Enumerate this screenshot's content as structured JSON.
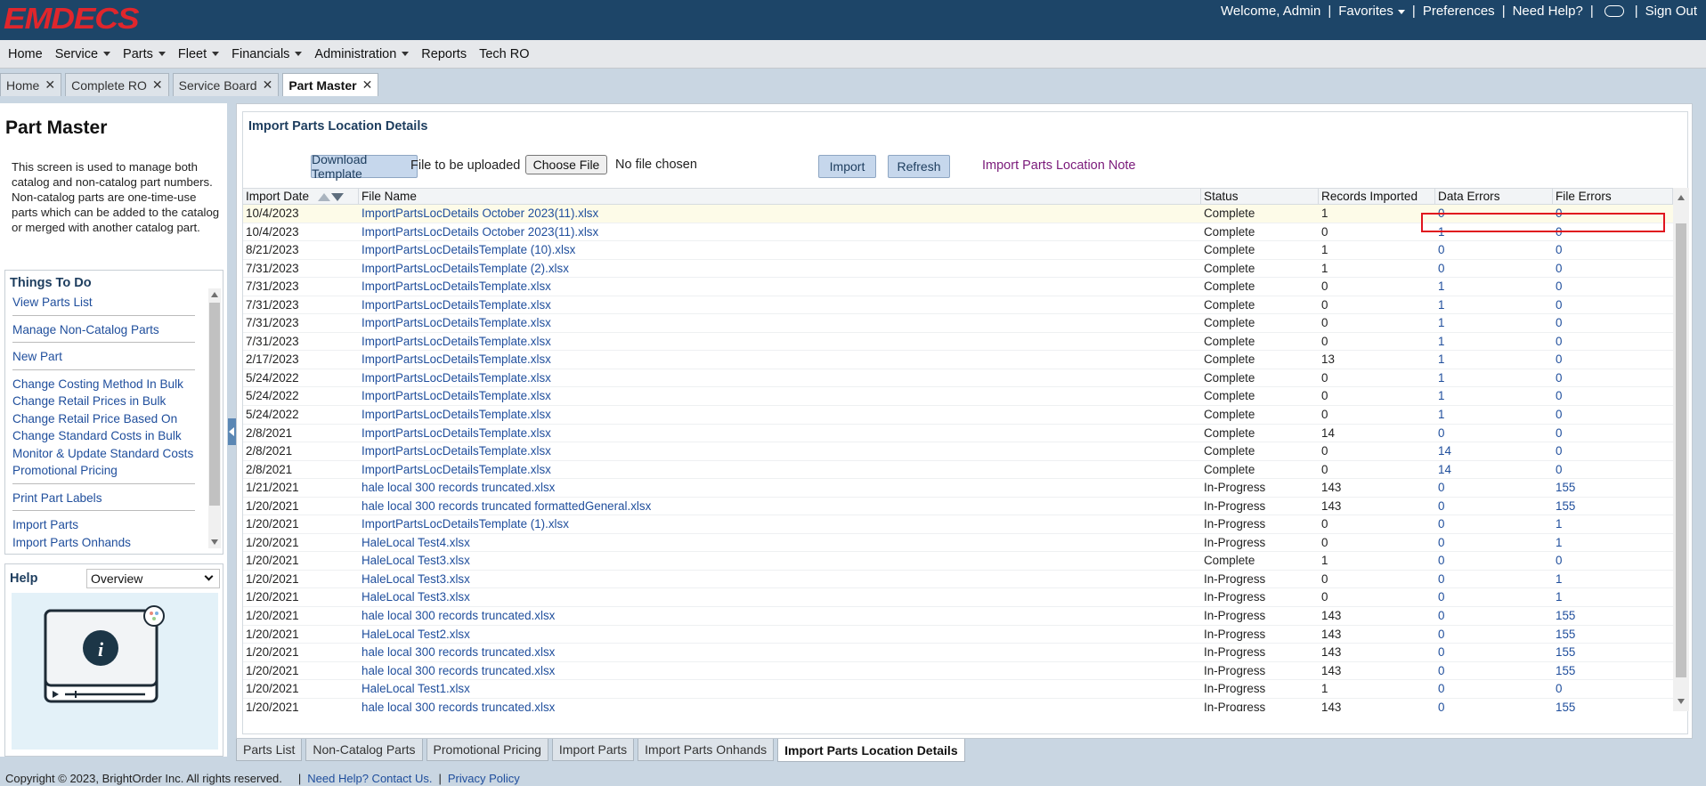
{
  "header": {
    "logo": "EMDECS",
    "welcome": "Welcome, Admin",
    "favorites": "Favorites",
    "preferences": "Preferences",
    "help": "Need Help?",
    "signout": "Sign Out"
  },
  "menu": [
    {
      "label": "Home",
      "dropdown": false
    },
    {
      "label": "Service",
      "dropdown": true
    },
    {
      "label": "Parts",
      "dropdown": true
    },
    {
      "label": "Fleet",
      "dropdown": true
    },
    {
      "label": "Financials",
      "dropdown": true
    },
    {
      "label": "Administration",
      "dropdown": true
    },
    {
      "label": "Reports",
      "dropdown": false
    },
    {
      "label": "Tech RO",
      "dropdown": false
    }
  ],
  "tabs": [
    {
      "label": "Home",
      "active": false
    },
    {
      "label": "Complete RO",
      "active": false
    },
    {
      "label": "Service Board",
      "active": false
    },
    {
      "label": "Part Master",
      "active": true
    }
  ],
  "left": {
    "title": "Part Master",
    "description": "This screen is used to manage both catalog and non-catalog part numbers. Non-catalog parts are one-time-use parts which can be added to the catalog or merged with another catalog part.",
    "things_title": "Things To Do",
    "things": [
      [
        "View Parts List"
      ],
      [
        "Manage Non-Catalog Parts"
      ],
      [
        "New Part"
      ],
      [
        "Change Costing Method In Bulk",
        "Change Retail Prices in Bulk",
        "Change Retail Price Based On",
        "Change Standard Costs in Bulk",
        "Monitor & Update Standard Costs",
        "Promotional Pricing"
      ],
      [
        "Print Part Labels"
      ],
      [
        "Import Parts",
        "Import Parts Onhands"
      ]
    ],
    "help_title": "Help",
    "help_select": "Overview"
  },
  "main": {
    "title": "Import Parts Location Details",
    "download_btn": "Download Template",
    "upload_label": "File to be uploaded",
    "choose_btn": "Choose File",
    "no_file": "No file chosen",
    "import_btn": "Import",
    "refresh_btn": "Refresh",
    "note_link": "Import Parts Location Note",
    "columns": [
      "Import Date",
      "File Name",
      "Status",
      "Records Imported",
      "Data Errors",
      "File Errors"
    ],
    "rows": [
      [
        "10/4/2023",
        "ImportPartsLocDetails October 2023(11).xlsx",
        "Complete",
        "1",
        "0",
        "0"
      ],
      [
        "10/4/2023",
        "ImportPartsLocDetails October 2023(11).xlsx",
        "Complete",
        "0",
        "1",
        "0"
      ],
      [
        "8/21/2023",
        "ImportPartsLocDetailsTemplate (10).xlsx",
        "Complete",
        "1",
        "0",
        "0"
      ],
      [
        "7/31/2023",
        "ImportPartsLocDetailsTemplate (2).xlsx",
        "Complete",
        "1",
        "0",
        "0"
      ],
      [
        "7/31/2023",
        "ImportPartsLocDetailsTemplate.xlsx",
        "Complete",
        "0",
        "1",
        "0"
      ],
      [
        "7/31/2023",
        "ImportPartsLocDetailsTemplate.xlsx",
        "Complete",
        "0",
        "1",
        "0"
      ],
      [
        "7/31/2023",
        "ImportPartsLocDetailsTemplate.xlsx",
        "Complete",
        "0",
        "1",
        "0"
      ],
      [
        "7/31/2023",
        "ImportPartsLocDetailsTemplate.xlsx",
        "Complete",
        "0",
        "1",
        "0"
      ],
      [
        "2/17/2023",
        "ImportPartsLocDetailsTemplate.xlsx",
        "Complete",
        "13",
        "1",
        "0"
      ],
      [
        "5/24/2022",
        "ImportPartsLocDetailsTemplate.xlsx",
        "Complete",
        "0",
        "1",
        "0"
      ],
      [
        "5/24/2022",
        "ImportPartsLocDetailsTemplate.xlsx",
        "Complete",
        "0",
        "1",
        "0"
      ],
      [
        "5/24/2022",
        "ImportPartsLocDetailsTemplate.xlsx",
        "Complete",
        "0",
        "1",
        "0"
      ],
      [
        "2/8/2021",
        "ImportPartsLocDetailsTemplate.xlsx",
        "Complete",
        "14",
        "0",
        "0"
      ],
      [
        "2/8/2021",
        "ImportPartsLocDetailsTemplate.xlsx",
        "Complete",
        "0",
        "14",
        "0"
      ],
      [
        "2/8/2021",
        "ImportPartsLocDetailsTemplate.xlsx",
        "Complete",
        "0",
        "14",
        "0"
      ],
      [
        "1/21/2021",
        "hale local 300 records truncated.xlsx",
        "In-Progress",
        "143",
        "0",
        "155"
      ],
      [
        "1/20/2021",
        "hale local 300 records truncated formattedGeneral.xlsx",
        "In-Progress",
        "143",
        "0",
        "155"
      ],
      [
        "1/20/2021",
        "ImportPartsLocDetailsTemplate (1).xlsx",
        "In-Progress",
        "0",
        "0",
        "1"
      ],
      [
        "1/20/2021",
        "HaleLocal Test4.xlsx",
        "In-Progress",
        "0",
        "0",
        "1"
      ],
      [
        "1/20/2021",
        "HaleLocal Test3.xlsx",
        "Complete",
        "1",
        "0",
        "0"
      ],
      [
        "1/20/2021",
        "HaleLocal Test3.xlsx",
        "In-Progress",
        "0",
        "0",
        "1"
      ],
      [
        "1/20/2021",
        "HaleLocal Test3.xlsx",
        "In-Progress",
        "0",
        "0",
        "1"
      ],
      [
        "1/20/2021",
        "hale local 300 records truncated.xlsx",
        "In-Progress",
        "143",
        "0",
        "155"
      ],
      [
        "1/20/2021",
        "HaleLocal Test2.xlsx",
        "In-Progress",
        "143",
        "0",
        "155"
      ],
      [
        "1/20/2021",
        "hale local 300 records truncated.xlsx",
        "In-Progress",
        "143",
        "0",
        "155"
      ],
      [
        "1/20/2021",
        "hale local 300 records truncated.xlsx",
        "In-Progress",
        "143",
        "0",
        "155"
      ],
      [
        "1/20/2021",
        "HaleLocal Test1.xlsx",
        "In-Progress",
        "1",
        "0",
        "0"
      ],
      [
        "1/20/2021",
        "hale local 300 records truncated.xlsx",
        "In-Progress",
        "143",
        "0",
        "155"
      ]
    ]
  },
  "bottom_tabs": [
    {
      "label": "Parts List",
      "active": false
    },
    {
      "label": "Non-Catalog Parts",
      "active": false
    },
    {
      "label": "Promotional Pricing",
      "active": false
    },
    {
      "label": "Import Parts",
      "active": false
    },
    {
      "label": "Import Parts Onhands",
      "active": false
    },
    {
      "label": "Import Parts Location Details",
      "active": true
    }
  ],
  "footer": {
    "copyright": "Copyright © 2023, BrightOrder Inc. All rights reserved.",
    "help": "Need Help? Contact Us.",
    "privacy": "Privacy Policy"
  },
  "colors": {
    "header_bg": "#1d4568",
    "logo_red": "#e0262c",
    "link_blue": "#1f4e9c",
    "highlight_red": "#e0141e"
  }
}
